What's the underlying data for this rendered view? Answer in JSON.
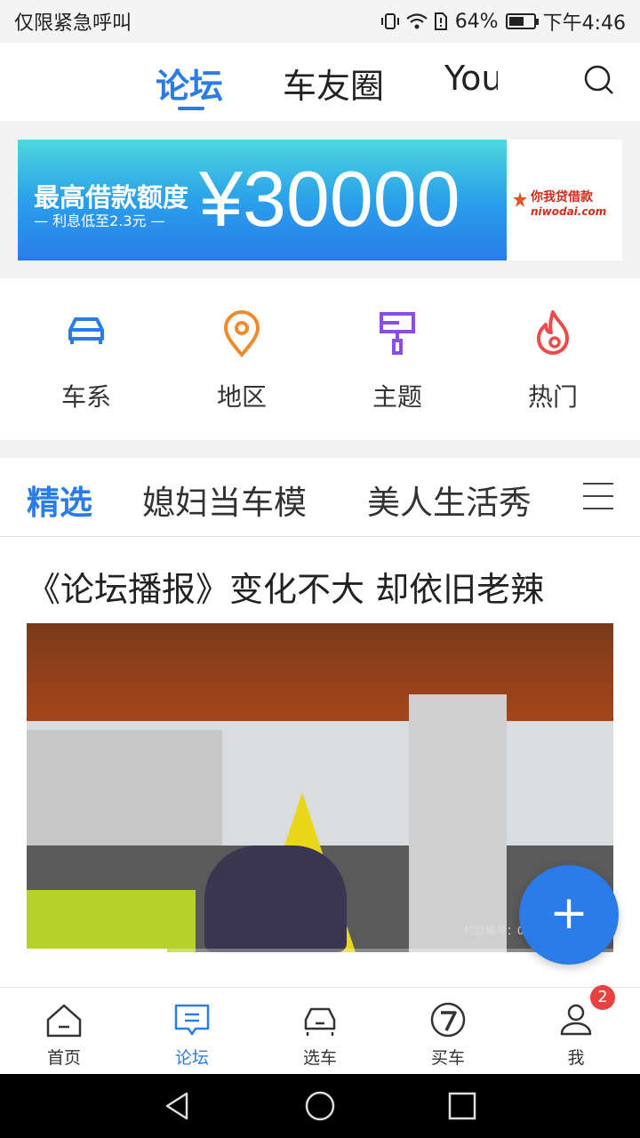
{
  "status": {
    "carrier": "仅限紧急呼叫",
    "battery": "64%",
    "battery_level": 0.64,
    "time": "下午4:46"
  },
  "topnav": {
    "tabs": [
      {
        "label": "论坛",
        "active": true
      },
      {
        "label": "车友圈"
      },
      {
        "label": "You"
      }
    ]
  },
  "banner": {
    "headline": "最高借款额度",
    "subline": "— 利息低至2.3元 —",
    "amount": "¥30000",
    "brand_cn": "你我贷借款",
    "brand_en": "niwodai.com"
  },
  "grid": [
    {
      "label": "车系",
      "icon": "car-icon"
    },
    {
      "label": "地区",
      "icon": "location-pin-icon"
    },
    {
      "label": "主题",
      "icon": "paintbrush-icon"
    },
    {
      "label": "热门",
      "icon": "flame-icon"
    }
  ],
  "categories": [
    {
      "label": "精选",
      "active": true
    },
    {
      "label": "媳妇当车模"
    },
    {
      "label": "美人生活秀"
    }
  ],
  "post": {
    "title": "《论坛播报》变化不大 却依旧老辣",
    "video_watermark": "栏目编号：01105",
    "progress": 0.24
  },
  "bottomnav": [
    {
      "label": "首页",
      "icon": "home-icon"
    },
    {
      "label": "论坛",
      "icon": "forum-icon",
      "active": true
    },
    {
      "label": "选车",
      "icon": "car-select-icon"
    },
    {
      "label": "买车",
      "icon": "buy-car-icon"
    },
    {
      "label": "我",
      "icon": "profile-icon",
      "badge": "2"
    }
  ],
  "colors": {
    "accent": "#2b7ce9",
    "badge": "#e94040"
  }
}
